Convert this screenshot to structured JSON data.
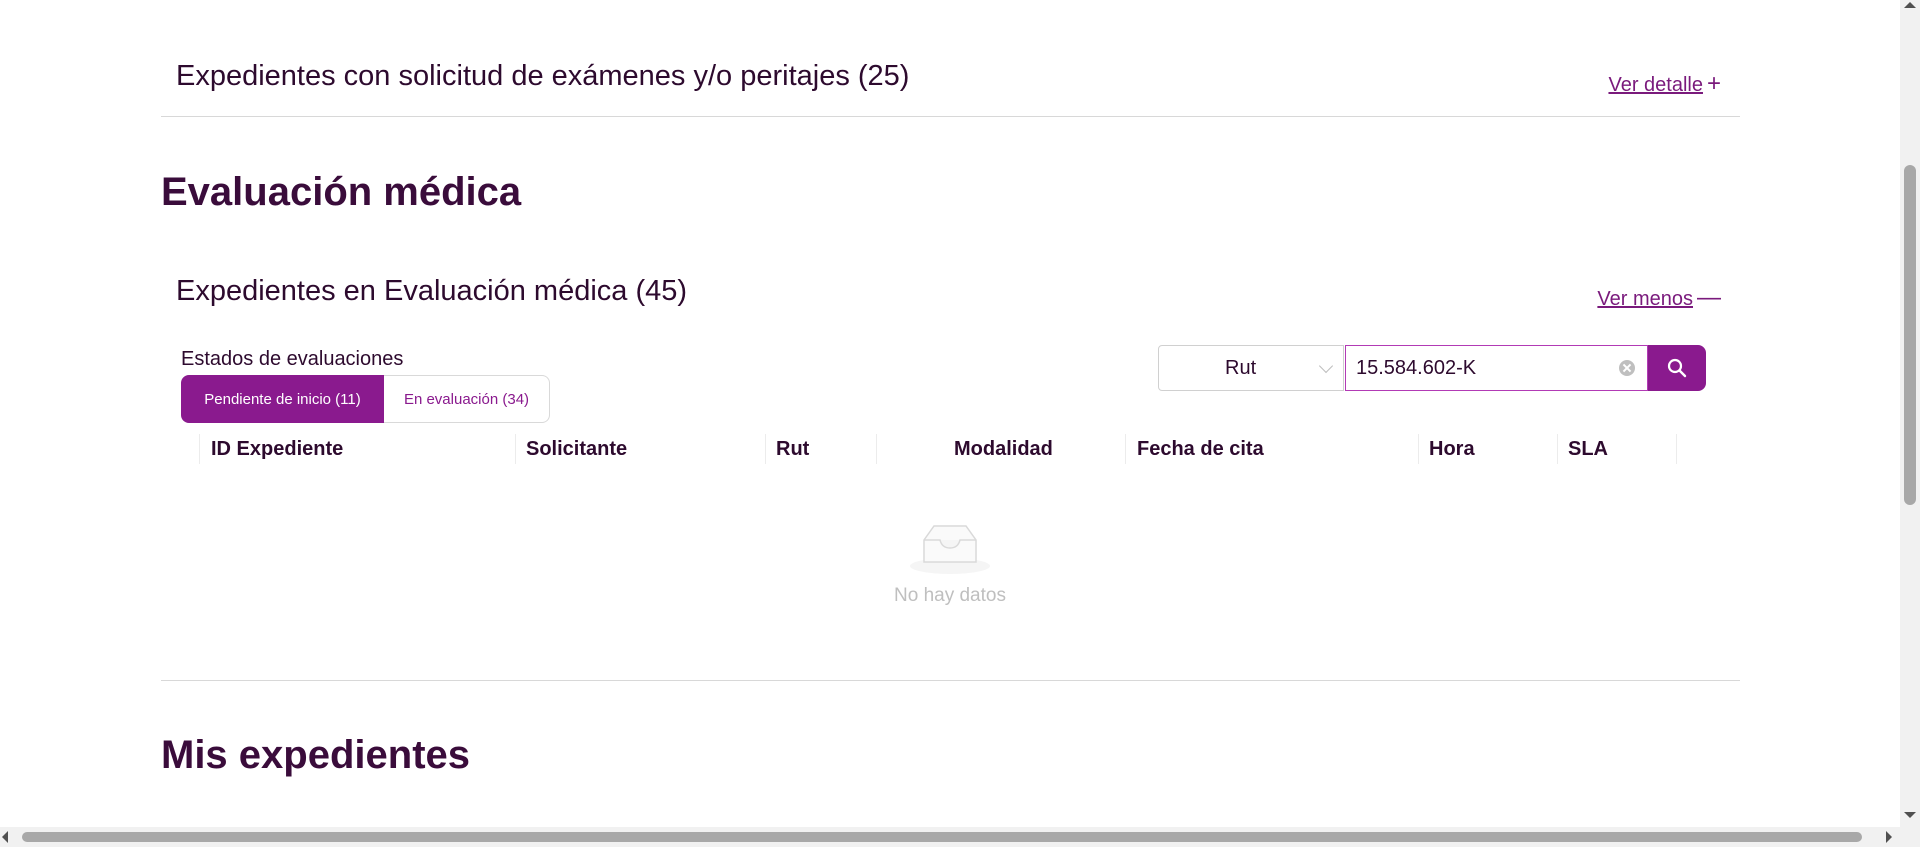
{
  "sections": {
    "examenes": {
      "title": "Expedientes con solicitud de exámenes y/o peritajes (25)",
      "link": "Ver detalle",
      "link_symbol": "+"
    },
    "evaluacion": {
      "heading": "Evaluación médica",
      "title": "Expedientes en Evaluación médica (45)",
      "link": "Ver menos",
      "link_symbol": "—",
      "states_label": "Estados de evaluaciones",
      "tabs": [
        {
          "label": "Pendiente de inicio (11)",
          "active": true
        },
        {
          "label": "En evaluación (34)",
          "active": false
        }
      ],
      "search": {
        "filter_value": "Rut",
        "input_value": "15.584.602-K"
      },
      "table": {
        "columns": [
          "ID Expediente",
          "Solicitante",
          "Rut",
          "Modalidad",
          "Fecha de cita",
          "Hora",
          "SLA"
        ],
        "empty_text": "No hay datos"
      }
    },
    "mis_expedientes": {
      "heading": "Mis expedientes"
    }
  },
  "colors": {
    "brand": "#8a1a8e",
    "heading": "#3a0c3b",
    "text": "#2d0a2e",
    "muted": "#bfbfbf"
  },
  "icons": [
    "plus-icon",
    "minus-icon",
    "chevron-down-icon",
    "clear-icon",
    "search-icon",
    "empty-inbox-icon"
  ]
}
